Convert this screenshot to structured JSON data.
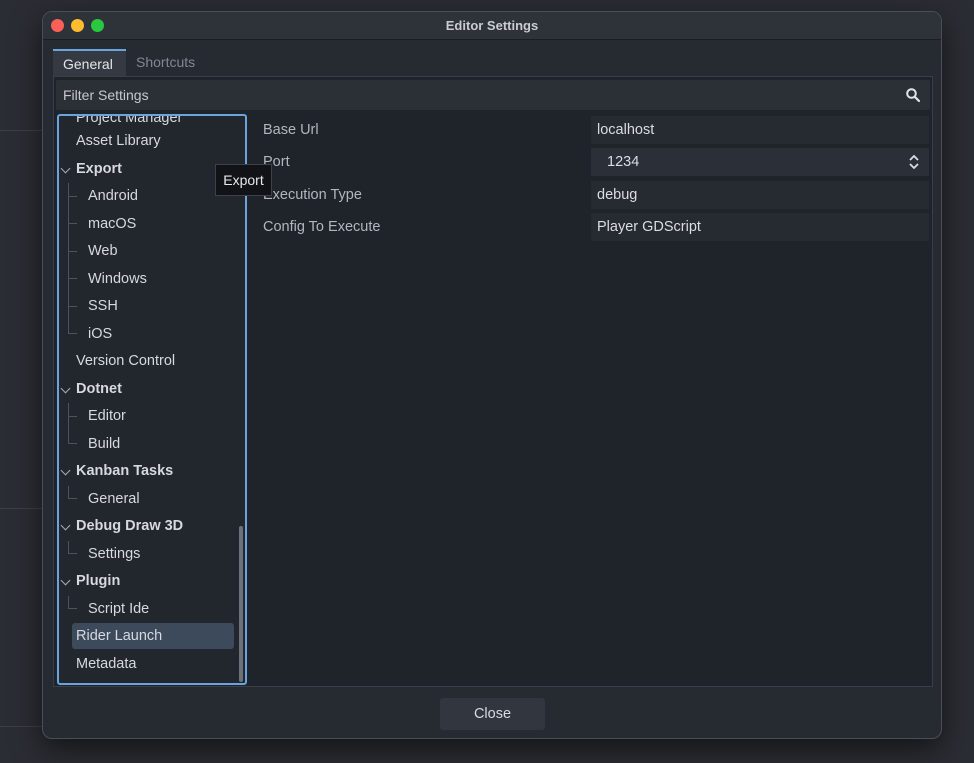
{
  "window": {
    "title": "Editor Settings"
  },
  "tabs": [
    {
      "label": "General",
      "active": true
    },
    {
      "label": "Shortcuts",
      "active": false
    }
  ],
  "filter": {
    "placeholder": "Filter Settings",
    "icon": "search-icon"
  },
  "tree": {
    "items": [
      {
        "label": "Project Manager",
        "kind": "top"
      },
      {
        "label": "Asset Library",
        "kind": "top"
      },
      {
        "label": "Export",
        "kind": "category",
        "expanded": true
      },
      {
        "label": "Android",
        "kind": "child"
      },
      {
        "label": "macOS",
        "kind": "child"
      },
      {
        "label": "Web",
        "kind": "child"
      },
      {
        "label": "Windows",
        "kind": "child"
      },
      {
        "label": "SSH",
        "kind": "child"
      },
      {
        "label": "iOS",
        "kind": "child"
      },
      {
        "label": "Version Control",
        "kind": "top"
      },
      {
        "label": "Dotnet",
        "kind": "category",
        "expanded": true
      },
      {
        "label": "Editor",
        "kind": "child"
      },
      {
        "label": "Build",
        "kind": "child"
      },
      {
        "label": "Kanban Tasks",
        "kind": "category",
        "expanded": true
      },
      {
        "label": "General",
        "kind": "child"
      },
      {
        "label": "Debug Draw 3D",
        "kind": "category",
        "expanded": true
      },
      {
        "label": "Settings",
        "kind": "child"
      },
      {
        "label": "Plugin",
        "kind": "category",
        "expanded": true
      },
      {
        "label": "Script Ide",
        "kind": "child"
      },
      {
        "label": "Rider Launch",
        "kind": "top",
        "selected": true
      },
      {
        "label": "Metadata",
        "kind": "top"
      }
    ]
  },
  "tooltip": {
    "text": "Export"
  },
  "properties": [
    {
      "label": "Base Url",
      "value": "localhost"
    },
    {
      "label": "Port",
      "value": "1234",
      "spinner": true
    },
    {
      "label": "Execution Type",
      "value": "debug"
    },
    {
      "label": "Config To Execute",
      "value": "Player GDScript"
    }
  ],
  "footer": {
    "close_label": "Close"
  },
  "colors": {
    "accent": "#6aa4df",
    "selection": "#3d4a5c",
    "background": "#1f232a"
  }
}
